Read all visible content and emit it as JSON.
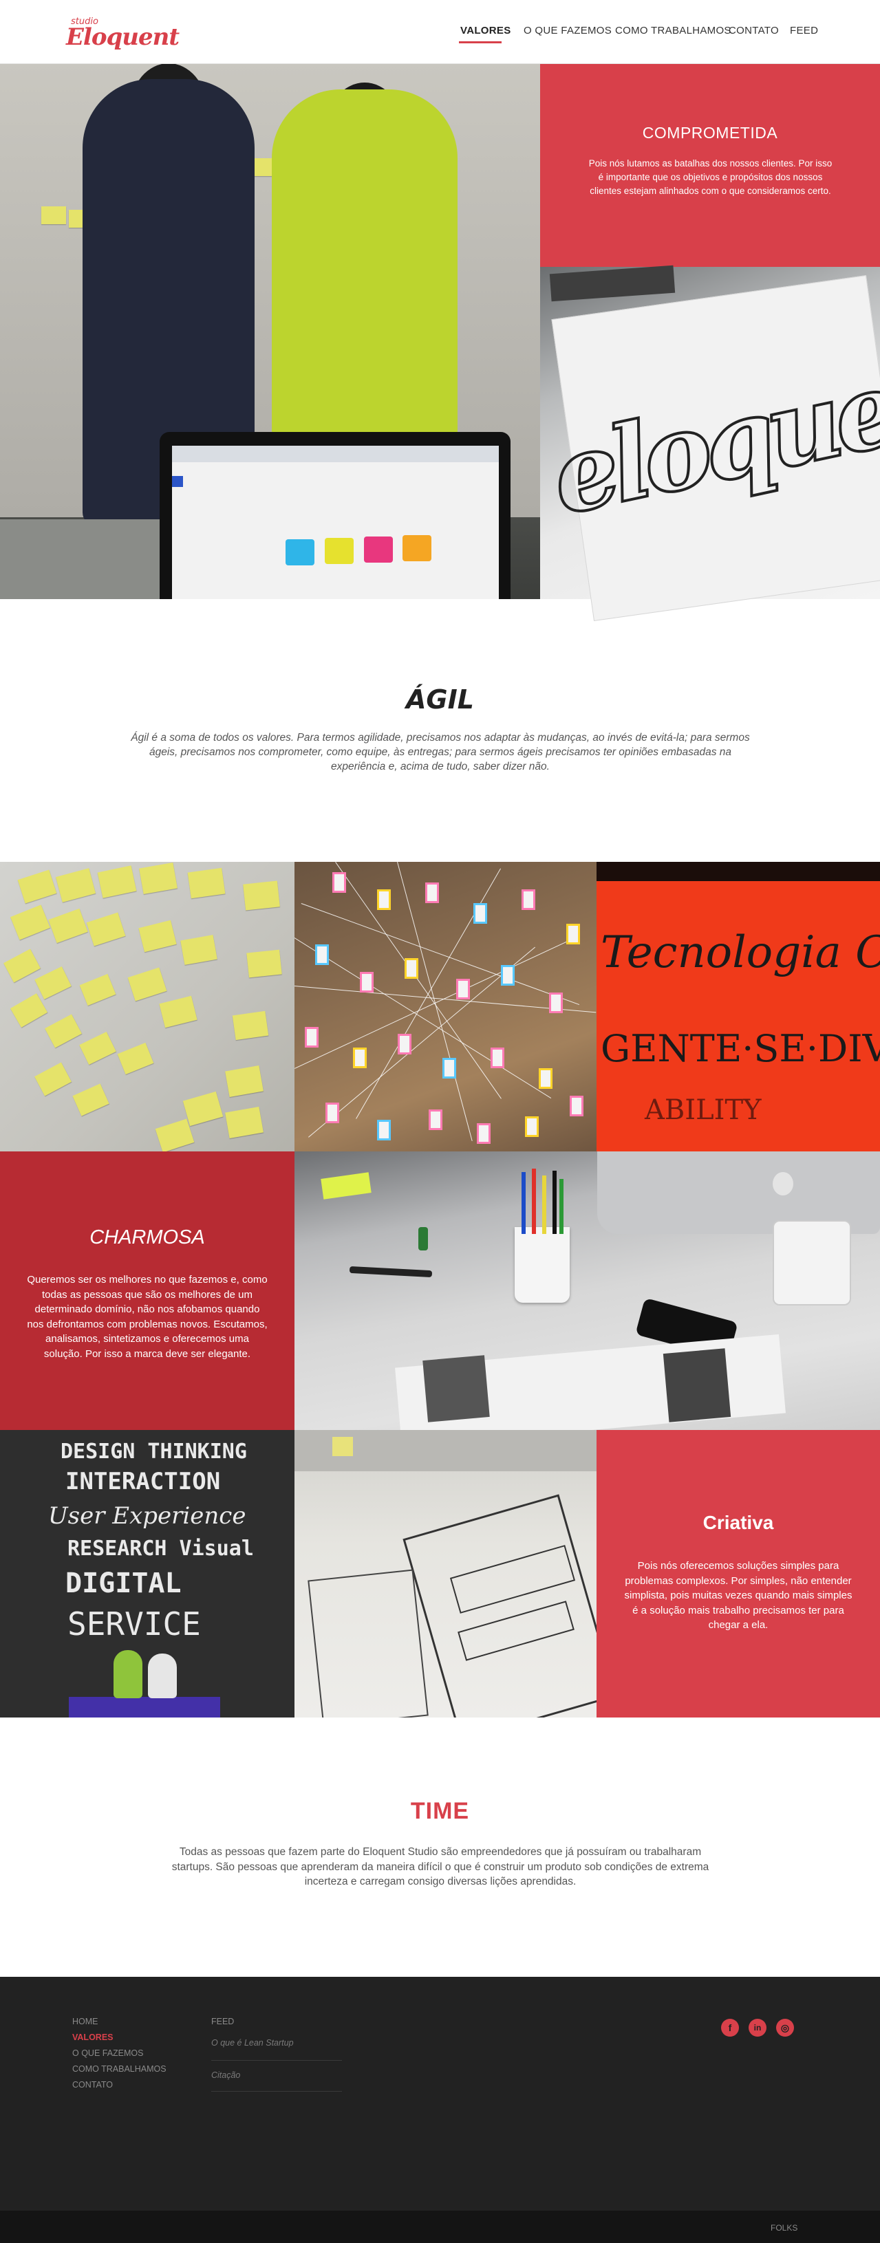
{
  "header": {
    "logo_small": "studio",
    "logo_main": "Eloquent",
    "nav": [
      "VALORES",
      "O QUE FAZEMOS",
      "COMO TRABALHAMOS",
      "CONTATO",
      "FEED"
    ],
    "active_nav": "VALORES"
  },
  "comprometida": {
    "title": "COMPROMETIDA",
    "text": "Pois nós lutamos as batalhas dos nossos clientes. Por isso é importante que os objetivos e propósitos dos nossos clientes estejam alinhados com o que consideramos certo."
  },
  "eloquent_drawing": "eloquent",
  "agil": {
    "title": "ÁGIL",
    "text": "Ágil é a soma de todos os valores. Para termos agilidade, precisamos nos adaptar às mudanças, ao invés de evitá-la; para sermos ágeis, precisamos nos comprometer, como equipe, às entregas; para sermos ágeis precisamos ter opiniões embasadas na experiência e, acima de tudo, saber dizer não."
  },
  "tecnologia_photo": {
    "line1": "Tecnologia C",
    "line2": "GENTE·SE·DIV",
    "line3": "ABILITY"
  },
  "charmosa": {
    "title": "CHARMOSA",
    "text": "Queremos ser os melhores no que fazemos e, como todas as pessoas que são os melhores de um determinado domínio, não nos afobamos quando nos defrontamos com problemas novos. Escutamos, analisamos, sintetizamos e oferecemos uma solução. Por isso a marca deve ser elegante."
  },
  "chalkboard": {
    "lines": [
      "DESIGN THINKING",
      "INTERACTION",
      "User Experience",
      "RESEARCH Visual",
      "DIGITAL",
      "SERVICE"
    ]
  },
  "criativa": {
    "title": "Criativa",
    "text": "Pois nós oferecemos soluções simples para problemas complexos. Por simples, não entender simplista, pois muitas vezes quando mais simples é a solução mais trabalho precisamos ter para chegar a ela."
  },
  "time": {
    "title": "TIME",
    "text": "Todas as pessoas que fazem parte do Eloquent Studio são empreendedores que já possuíram ou trabalharam  startups. São pessoas que aprenderam da maneira difícil o que é construir um produto sob condições de extrema incerteza e carregam consigo diversas lições aprendidas."
  },
  "footer": {
    "links": [
      "HOME",
      "VALORES",
      "O QUE FAZEMOS",
      "COMO TRABALHAMOS",
      "CONTATO"
    ],
    "active_link": "VALORES",
    "feed_title": "FEED",
    "feed_items": [
      "O que é Lean Startup",
      "Citação"
    ],
    "social": [
      "f",
      "in",
      "◎"
    ],
    "bottom_text": "FOLKS"
  }
}
